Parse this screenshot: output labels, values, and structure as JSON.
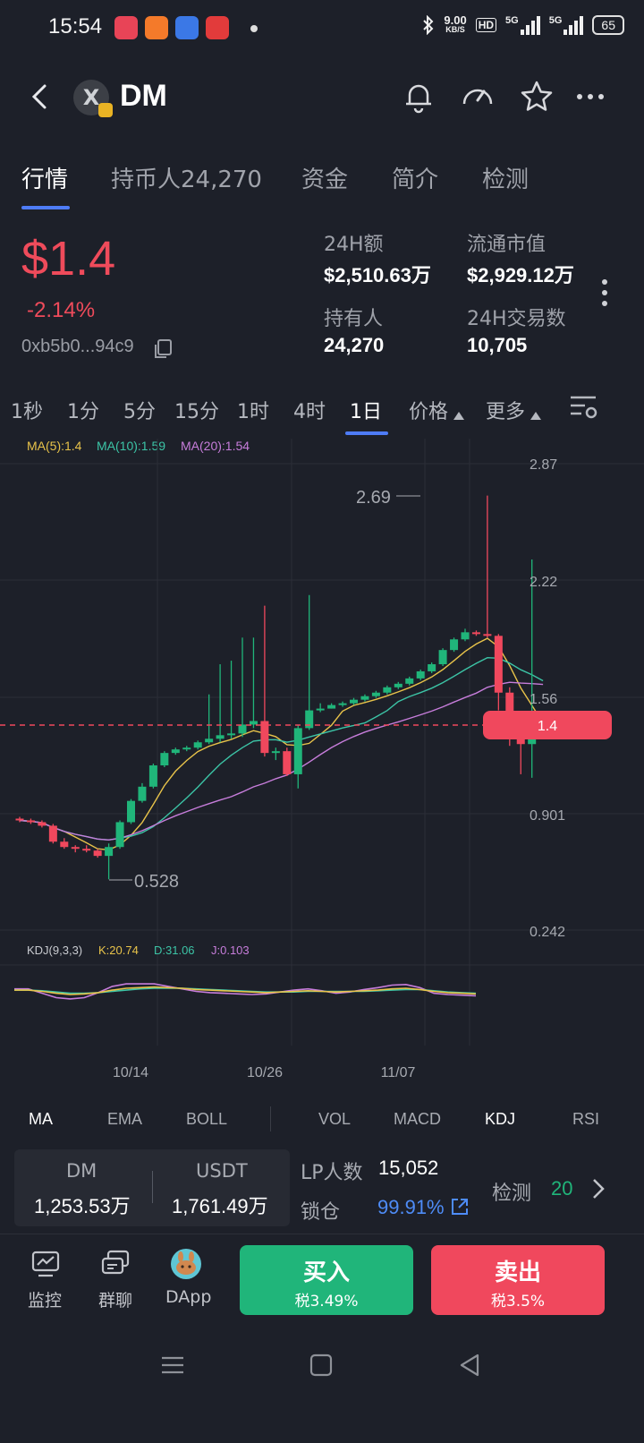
{
  "status_bar": {
    "time": "15:54",
    "net_speed": "9.00",
    "net_unit": "KB/S",
    "hd": "HD",
    "sig1": "5G",
    "sig2": "5G",
    "battery": "65",
    "icons": [
      "music-app-icon",
      "social-app-icon",
      "browser-app-icon",
      "news-app-icon",
      "bluetooth-icon"
    ]
  },
  "header": {
    "token_name": "DM",
    "icons": [
      "back-icon",
      "token-logo-icon",
      "bell-icon",
      "gauge-icon",
      "star-icon",
      "more-icon"
    ]
  },
  "tabs": [
    {
      "label": "行情",
      "active": true
    },
    {
      "label": "持币人24,270",
      "active": false
    },
    {
      "label": "资金",
      "active": false
    },
    {
      "label": "简介",
      "active": false
    },
    {
      "label": "检测",
      "active": false
    }
  ],
  "price_block": {
    "price": "$1.4",
    "change": "-2.14%",
    "address": "0xb5b0...94c9",
    "stats": [
      {
        "label": "24H额",
        "value": "$2,510.63万"
      },
      {
        "label": "流通市值",
        "value": "$2,929.12万"
      },
      {
        "label": "持有人",
        "value": "24,270"
      },
      {
        "label": "24H交易数",
        "value": "10,705"
      }
    ]
  },
  "timeframes": [
    "1秒",
    "1分",
    "5分",
    "15分",
    "1时",
    "4时",
    "1日"
  ],
  "timeframe_active": "1日",
  "dropdowns": {
    "price": "价格",
    "more": "更多"
  },
  "ma_legend": {
    "ma5": "MA(5):1.4",
    "ma10": "MA(10):1.59",
    "ma20": "MA(20):1.54"
  },
  "kdj_legend": {
    "name": "KDJ(9,3,3)",
    "k": "K:20.74",
    "d": "D:31.06",
    "j": "J:0.103"
  },
  "chart_data": {
    "type": "candlestick",
    "y_axis_labels": [
      "2.87",
      "2.22",
      "1.56",
      "0.901",
      "0.242"
    ],
    "x_axis_labels": [
      "10/14",
      "10/26",
      "11/07"
    ],
    "current_price_label": "1.4",
    "high_annotation": "2.69",
    "low_annotation": "0.528",
    "ylim": [
      0.242,
      2.87
    ],
    "candles": [
      [
        0.87,
        0.86,
        0.88,
        0.85
      ],
      [
        0.86,
        0.85,
        0.87,
        0.84
      ],
      [
        0.85,
        0.83,
        0.86,
        0.82
      ],
      [
        0.83,
        0.74,
        0.84,
        0.73
      ],
      [
        0.74,
        0.71,
        0.76,
        0.7
      ],
      [
        0.71,
        0.7,
        0.72,
        0.68
      ],
      [
        0.7,
        0.69,
        0.72,
        0.68
      ],
      [
        0.69,
        0.66,
        0.7,
        0.65
      ],
      [
        0.66,
        0.71,
        0.73,
        0.528
      ],
      [
        0.71,
        0.85,
        0.86,
        0.7
      ],
      [
        0.85,
        0.97,
        0.98,
        0.84
      ],
      [
        0.97,
        1.05,
        1.07,
        0.96
      ],
      [
        1.05,
        1.17,
        1.18,
        1.04
      ],
      [
        1.17,
        1.24,
        1.25,
        1.16
      ],
      [
        1.24,
        1.26,
        1.27,
        1.23
      ],
      [
        1.26,
        1.27,
        1.28,
        1.25
      ],
      [
        1.27,
        1.3,
        1.31,
        1.26
      ],
      [
        1.3,
        1.32,
        1.57,
        1.29
      ],
      [
        1.32,
        1.34,
        1.74,
        1.3
      ],
      [
        1.34,
        1.35,
        1.76,
        1.32
      ],
      [
        1.35,
        1.4,
        1.89,
        1.33
      ],
      [
        1.4,
        1.42,
        1.89,
        1.38
      ],
      [
        1.42,
        1.24,
        2.07,
        1.22
      ],
      [
        1.24,
        1.25,
        1.27,
        1.2
      ],
      [
        1.25,
        1.12,
        1.27,
        1.11
      ],
      [
        1.12,
        1.38,
        1.4,
        1.04
      ],
      [
        1.38,
        1.48,
        2.13,
        1.37
      ],
      [
        1.48,
        1.49,
        1.52,
        1.47
      ],
      [
        1.49,
        1.51,
        1.52,
        1.49
      ],
      [
        1.51,
        1.52,
        1.53,
        1.5
      ],
      [
        1.52,
        1.54,
        1.55,
        1.51
      ],
      [
        1.54,
        1.56,
        1.57,
        1.53
      ],
      [
        1.56,
        1.58,
        1.59,
        1.55
      ],
      [
        1.58,
        1.61,
        1.62,
        1.57
      ],
      [
        1.61,
        1.63,
        1.64,
        1.6
      ],
      [
        1.63,
        1.66,
        1.67,
        1.62
      ],
      [
        1.66,
        1.7,
        1.71,
        1.65
      ],
      [
        1.7,
        1.74,
        1.75,
        1.69
      ],
      [
        1.74,
        1.82,
        1.83,
        1.73
      ],
      [
        1.82,
        1.88,
        1.89,
        1.81
      ],
      [
        1.88,
        1.92,
        1.94,
        1.87
      ],
      [
        1.92,
        1.91,
        1.93,
        1.9
      ],
      [
        1.91,
        1.9,
        2.69,
        1.89
      ],
      [
        1.9,
        1.58,
        1.91,
        1.48
      ],
      [
        1.58,
        1.35,
        1.61,
        1.28
      ],
      [
        1.35,
        1.29,
        1.4,
        1.12
      ],
      [
        1.29,
        1.42,
        2.33,
        1.1
      ],
      [
        1.42,
        1.4,
        1.45,
        1.39
      ]
    ],
    "kdj": {
      "k": [
        52,
        52,
        50,
        47,
        45,
        46,
        48,
        52,
        55,
        56,
        57,
        56,
        55,
        53,
        52,
        51,
        50,
        49,
        48,
        49,
        50,
        51,
        50,
        49,
        50,
        51,
        52,
        54,
        55,
        53,
        50,
        48,
        47,
        46
      ],
      "d": [
        52,
        52,
        51,
        49,
        47,
        47,
        48,
        50,
        52,
        54,
        55,
        55,
        55,
        54,
        53,
        52,
        51,
        50,
        49,
        49,
        49,
        50,
        50,
        50,
        50,
        50,
        51,
        52,
        53,
        53,
        51,
        49,
        48,
        47
      ],
      "j": [
        54,
        54,
        47,
        40,
        38,
        40,
        48,
        58,
        62,
        62,
        62,
        58,
        54,
        50,
        48,
        47,
        46,
        45,
        46,
        49,
        52,
        54,
        51,
        47,
        49,
        53,
        56,
        60,
        61,
        56,
        47,
        45,
        44,
        43
      ]
    }
  },
  "indicators": {
    "left": [
      "MA",
      "EMA",
      "BOLL"
    ],
    "right": [
      "VOL",
      "MACD",
      "KDJ",
      "RSI"
    ],
    "active_left": "MA",
    "active_right": "KDJ"
  },
  "pool": {
    "token_label": "DM",
    "token_value": "1,253.53万",
    "quote_label": "USDT",
    "quote_value": "1,761.49万",
    "lp_label": "LP人数",
    "lp_value": "15,052",
    "lock_label": "锁仓",
    "lock_value": "99.91%",
    "check_label": "检测",
    "check_value": "20"
  },
  "bottom_nav": {
    "monitor": "监控",
    "group": "群聊",
    "dapp": "DApp",
    "buy": "买入",
    "buy_tax": "税3.49%",
    "sell": "卖出",
    "sell_tax": "税3.5%"
  },
  "colors": {
    "bg": "#1d2029",
    "up": "#20b57a",
    "down": "#f0485d",
    "accent": "#4e7cf7",
    "ma5": "#e8c34a",
    "ma10": "#3cc4a6",
    "ma20": "#c77ddb"
  }
}
